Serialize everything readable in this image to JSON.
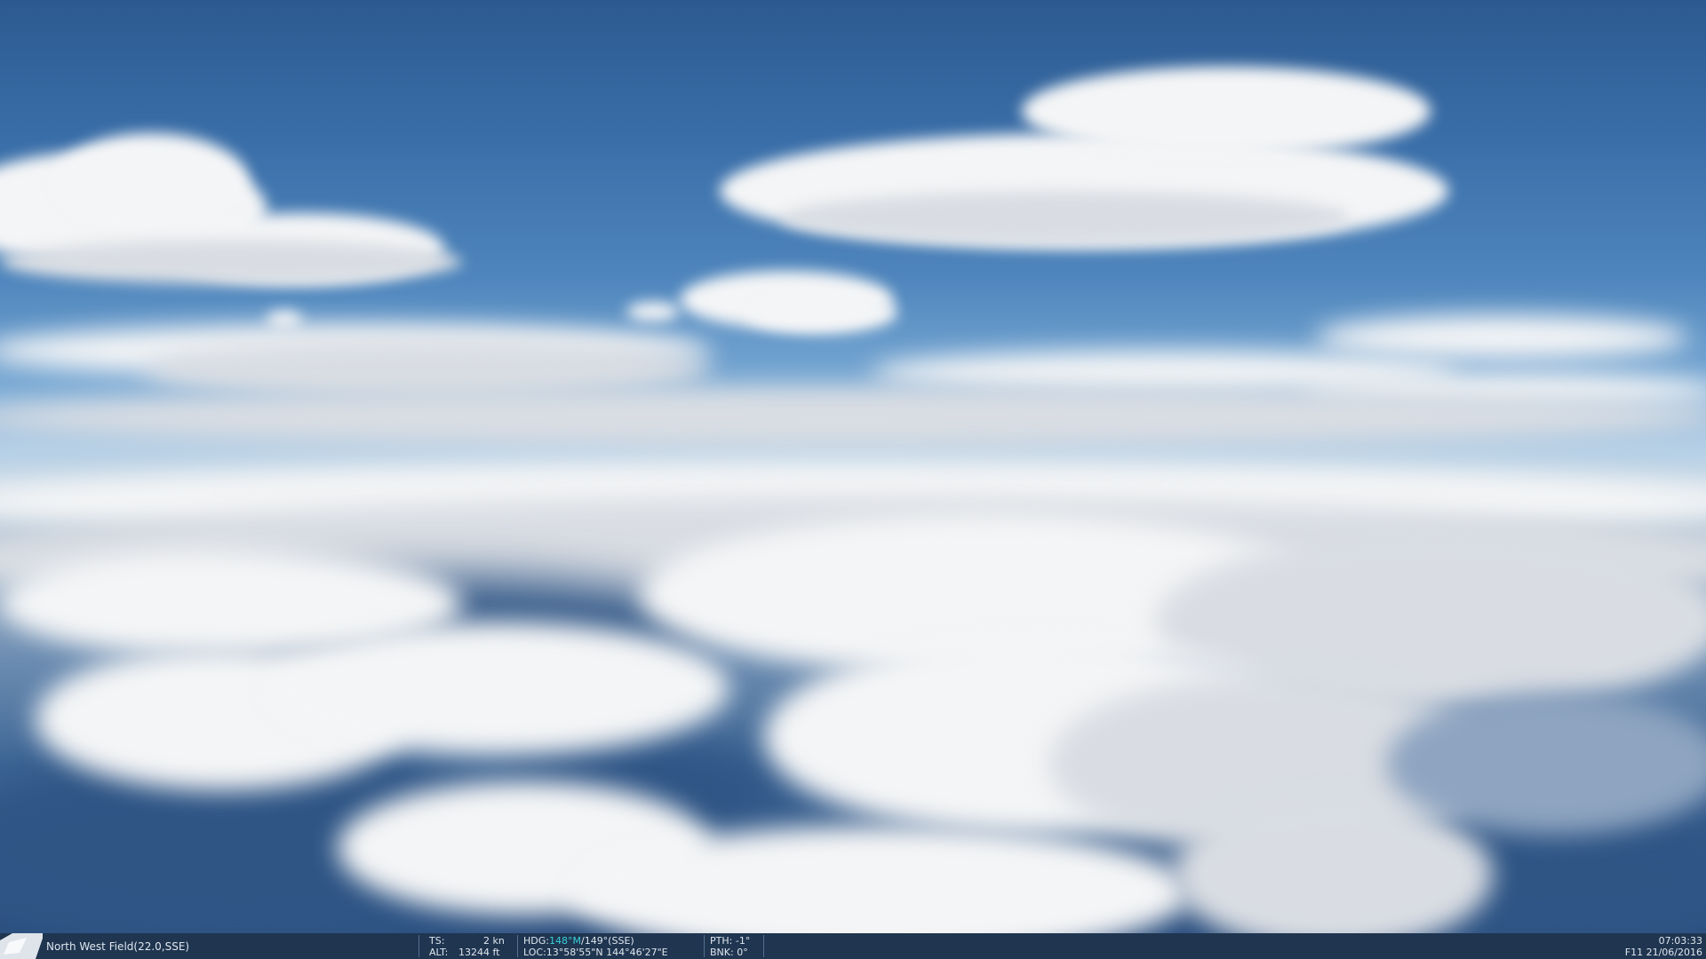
{
  "hud": {
    "location": "North West Field(22.0,SSE)",
    "ts_label": "TS:",
    "ts_value": "2",
    "ts_unit": "kn",
    "alt_label": "ALT:",
    "alt_value": "13244",
    "alt_unit": "ft",
    "hdg_label": "HDG:",
    "hdg_magnetic": "148°M",
    "hdg_true": "/149°(SSE)",
    "loc_label": "LOC:",
    "loc_value": "13°58'55\"N 144°46'27\"E",
    "pth_label": "PTH:",
    "pth_value": "-1°",
    "bnk_label": "BNK:",
    "bnk_value": "0°",
    "time": "07:03:33",
    "date_line": "F11 21/06/2016"
  },
  "colors": {
    "hud_background": "#1f3550",
    "hud_text": "#dfe6ee",
    "hud_accent": "#39d0d8",
    "sky_top": "#2c5a90",
    "horizon": "#c9d9e6"
  }
}
